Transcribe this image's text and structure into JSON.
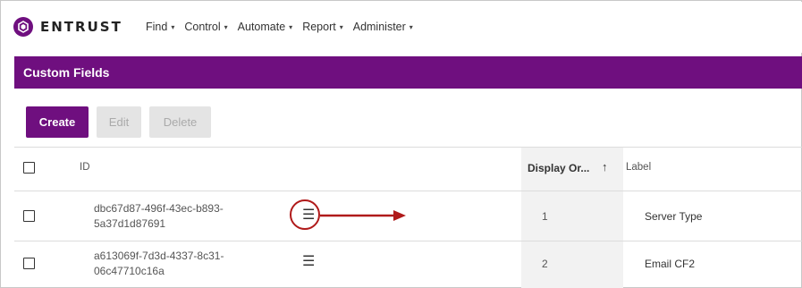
{
  "brand": {
    "name": "ENTRUST",
    "color": "#6f0f7f"
  },
  "nav": [
    {
      "label": "Find"
    },
    {
      "label": "Control"
    },
    {
      "label": "Automate"
    },
    {
      "label": "Report"
    },
    {
      "label": "Administer"
    }
  ],
  "nav_caret": "▾",
  "page": {
    "title": "Custom Fields"
  },
  "toolbar": {
    "create_label": "Create",
    "edit_label": "Edit",
    "delete_label": "Delete"
  },
  "grid": {
    "headers": {
      "id": "ID",
      "display_order": "Display Or...",
      "sort_arrow": "↑",
      "label": "Label"
    },
    "rows": [
      {
        "id_line1": "dbc67d87-496f-43ec-b893-",
        "id_line2": "5a37d1d87691",
        "handle": "☰",
        "display_order": "1",
        "label": "Server Type"
      },
      {
        "id_line1": "a613069f-7d3d-4337-8c31-",
        "id_line2": "06c47710c16a",
        "handle": "☰",
        "display_order": "2",
        "label": "Email CF2"
      }
    ]
  },
  "icons": {
    "logo": "entrust-logo-icon",
    "drag_handle": "drag-handle-icon",
    "callout": "callout-arrow-icon"
  },
  "colors": {
    "primary": "#6f0f7f",
    "callout": "#b01a1a"
  }
}
